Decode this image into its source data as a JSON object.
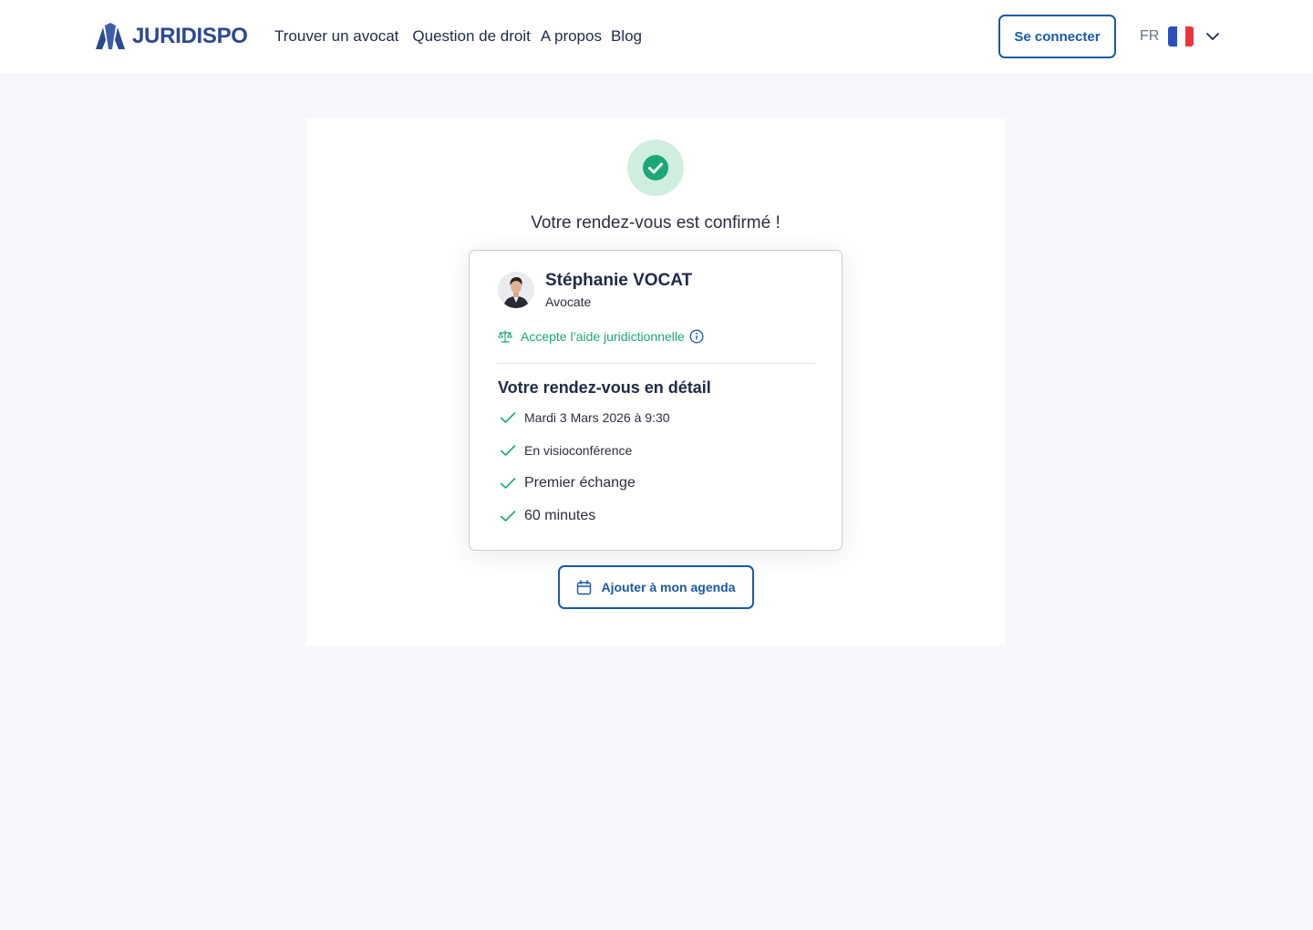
{
  "header": {
    "logo_text": "JURIDISPO",
    "nav": [
      "Trouver un avocat",
      "Question de droit",
      "A propos",
      "Blog"
    ],
    "login_label": "Se connecter",
    "language_code": "FR",
    "language_flag_icon": "france-flag-icon"
  },
  "colors": {
    "brand": "#2b4a8f",
    "primary": "#1858a8",
    "success": "#1aa878",
    "success_bg": "#cfeee0",
    "page_bg": "#f7f8fc"
  },
  "confirmation": {
    "status_icon": "check-circle-icon",
    "title": "Votre rendez-vous est confirmé !"
  },
  "lawyer": {
    "name": "Stéphanie VOCAT",
    "role": "Avocate",
    "legal_aid": "Accepte l’aide juridictionnelle"
  },
  "appointment": {
    "section_title": "Votre rendez-vous en détail",
    "details": [
      "Mardi 3 Mars 2026 à 9:30",
      "En visioconférence",
      "Premier échange",
      "60 minutes"
    ]
  },
  "actions": {
    "add_to_calendar": "Ajouter à mon agenda"
  }
}
